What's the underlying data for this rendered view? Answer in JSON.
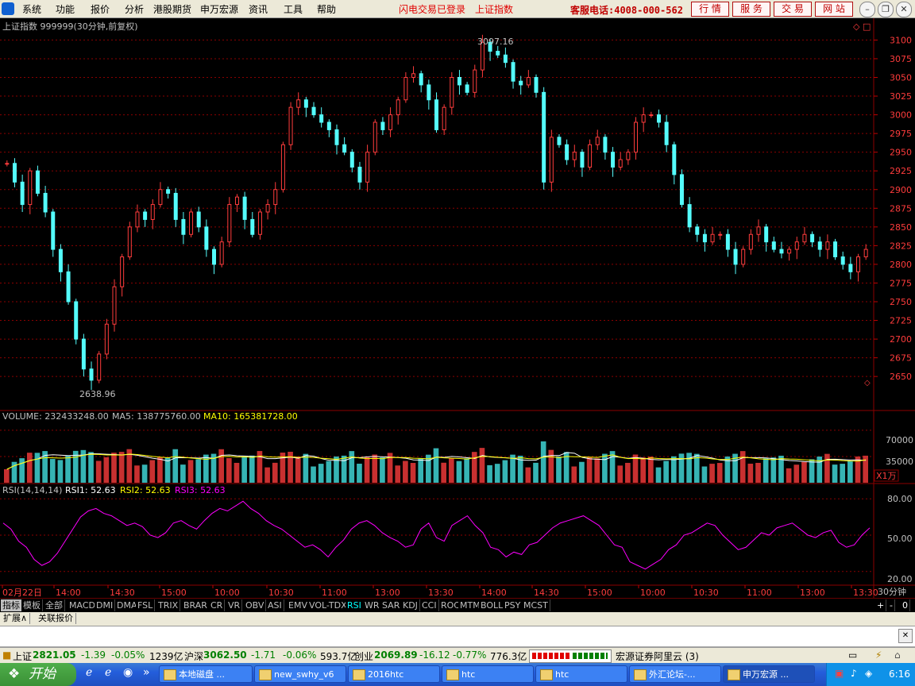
{
  "menu": {
    "items": [
      "系统",
      "功能",
      "报价",
      "分析",
      "港股期货",
      "申万宏源",
      "资讯",
      "工具",
      "帮助"
    ],
    "flash_login": "闪电交易已登录",
    "current_index": "上证指数",
    "hotline": "客服电话:4008-000-562",
    "buttons": [
      "行 情",
      "服 务",
      "交 易",
      "网 站"
    ]
  },
  "chart": {
    "title": "上证指数 999999(30分钟,前复权)",
    "high_label": "3097.16",
    "low_label": "2638.96",
    "price_ticks": [
      "3100",
      "3075",
      "3050",
      "3025",
      "3000",
      "2975",
      "2950",
      "2925",
      "2900",
      "2875",
      "2850",
      "2825",
      "2800",
      "2775",
      "2750",
      "2725",
      "2700",
      "2675",
      "2650"
    ],
    "volume_prefix": "VOLUME: 232433248.00",
    "ma5": "MA5: 138775760.00",
    "ma10": "MA10: 165381728.00",
    "volume_ticks": [
      "70000",
      "35000"
    ],
    "volume_unit": "X1万",
    "rsi_prefix": "RSI(14,14,14)",
    "rsi1": "RSI1: 52.63",
    "rsi2": "RSI2: 52.63",
    "rsi3": "RSI3: 52.63",
    "rsi_ticks": [
      "80.00",
      "50.00",
      "20.00"
    ],
    "time_labels": [
      "02月22日",
      "14:00",
      "14:30",
      "15:00",
      "10:00",
      "10:30",
      "11:00",
      "13:00",
      "13:30",
      "14:00",
      "14:30",
      "15:00",
      "10:00",
      "10:30",
      "11:00",
      "13:00",
      "13:30"
    ],
    "period_label": "30分钟"
  },
  "chart_data": {
    "type": "line",
    "title": "上证指数 999999(30分钟,前复权)",
    "ylim": [
      2630,
      3110
    ],
    "series": [
      {
        "name": "上证指数",
        "values": [
          2935,
          2910,
          2880,
          2925,
          2895,
          2870,
          2820,
          2790,
          2750,
          2700,
          2660,
          2645,
          2680,
          2720,
          2770,
          2810,
          2850,
          2870,
          2860,
          2880,
          2900,
          2895,
          2860,
          2840,
          2870,
          2850,
          2820,
          2800,
          2830,
          2880,
          2890,
          2860,
          2840,
          2870,
          2880,
          2900,
          2960,
          3010,
          3020,
          3010,
          3000,
          2990,
          2980,
          2960,
          2950,
          2930,
          2910,
          2950,
          2990,
          2980,
          3000,
          3020,
          3050,
          3055,
          3040,
          3020,
          2980,
          3010,
          3050,
          3040,
          3030,
          3060,
          3097,
          3085,
          3080,
          3070,
          3045,
          3040,
          3050,
          3030,
          2910,
          2970,
          2960,
          2940,
          2950,
          2930,
          2960,
          2970,
          2950,
          2930,
          2940,
          2950,
          2990,
          3000,
          3000,
          2990,
          2960,
          2920,
          2880,
          2850,
          2840,
          2830,
          2840,
          2840,
          2820,
          2800,
          2820,
          2840,
          2850,
          2830,
          2820,
          2815,
          2820,
          2830,
          2840,
          2830,
          2820,
          2830,
          2810,
          2800,
          2790,
          2810,
          2820
        ]
      }
    ],
    "volume_ylim": [
      0,
      90000
    ],
    "rsi_ylim": [
      10,
      90
    ],
    "rsi_series": [
      {
        "name": "RSI1",
        "values": [
          60,
          55,
          45,
          40,
          30,
          25,
          28,
          35,
          45,
          55,
          65,
          70,
          72,
          68,
          66,
          62,
          58,
          60,
          57,
          50,
          48,
          52,
          60,
          62,
          58,
          55,
          62,
          68,
          72,
          70,
          74,
          78,
          72,
          68,
          62,
          58,
          55,
          50,
          45,
          40,
          42,
          38,
          32,
          40,
          46,
          55,
          60,
          62,
          58,
          52,
          48,
          45,
          40,
          42,
          55,
          60,
          48,
          45,
          58,
          62,
          66,
          58,
          52,
          40,
          38,
          32,
          36,
          34,
          42,
          44,
          50,
          56,
          60,
          62,
          64,
          66,
          62,
          58,
          50,
          42,
          40,
          28,
          25,
          22,
          26,
          30,
          38,
          42,
          50,
          52,
          56,
          60,
          58,
          50,
          44,
          38,
          40,
          46,
          52,
          50,
          56,
          58,
          60,
          55,
          50,
          48,
          52,
          54,
          44,
          40,
          42,
          50,
          56
        ]
      }
    ]
  },
  "tabs": [
    "指标",
    "模板",
    "全部",
    "MACD",
    "DMI",
    "DMA",
    "FSL",
    "TRIX",
    "BRAR",
    "CR",
    "VR",
    "OBV",
    "ASI",
    "EMV",
    "VOL-TDX",
    "RSI",
    "WR",
    "SAR",
    "KDJ",
    "CCI",
    "ROC",
    "MTM",
    "BOLL",
    "PSY",
    "MCST"
  ],
  "tab_right": [
    "+",
    "-",
    "0"
  ],
  "subtabs": [
    "扩展∧",
    "关联报价"
  ],
  "status": {
    "sh_label": "上证",
    "sh_value": "2821.05",
    "sh_change": "-1.39",
    "sh_pct": "-0.05%",
    "sh_amount": "1239亿",
    "hs_label": "沪深",
    "hs_value": "3062.50",
    "hs_change": "-1.71",
    "hs_pct": "-0.06%",
    "hs_amount": "593.7亿",
    "cy_label": "创业",
    "cy_value": "2069.89",
    "cy_change": "-16.12",
    "cy_pct": "-0.77%",
    "cy_amount": "776.3亿",
    "broker": "宏源证券阿里云 (3)"
  },
  "taskbar": {
    "start": "开始",
    "tasks": [
      "本地磁盘 ...",
      "new_swhy_v6",
      "2016htc",
      "htc",
      "htc",
      "外汇论坛-...",
      "申万宏源 ..."
    ],
    "clock": "6:16"
  },
  "colors": {
    "up": "#ff3c3c",
    "down": "#54fcfc",
    "grid": "#8b0000",
    "ma10": "#ffff00",
    "rsi": "#ff00ff"
  }
}
